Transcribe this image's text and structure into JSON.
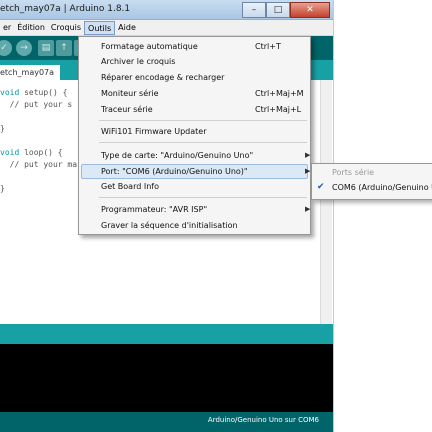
{
  "window": {
    "title": "etch_may07a | Arduino 1.8.1",
    "buttons": {
      "minimize": "–",
      "maximize": "□",
      "close": "✕"
    }
  },
  "menubar": {
    "items": [
      "er",
      "Édition",
      "Croquis",
      "Outils",
      "Aide"
    ],
    "active": "Outils"
  },
  "toolbar": {
    "icons": [
      "verify-icon",
      "upload-icon",
      "new-icon",
      "open-icon",
      "save-icon"
    ]
  },
  "editor": {
    "tab_label": "etch_may07a",
    "lines": [
      {
        "kw": "void",
        "rest": " setup() {"
      },
      {
        "kw": "",
        "rest": "  // put your s"
      },
      {
        "kw": "",
        "rest": "}"
      },
      {
        "kw": "void",
        "rest": " loop() {"
      },
      {
        "kw": "",
        "rest": "  // put your ma"
      },
      {
        "kw": "",
        "rest": "}"
      }
    ]
  },
  "tools_menu": {
    "items": [
      {
        "label": "Formatage automatique",
        "shortcut": "Ctrl+T"
      },
      {
        "label": "Archiver le croquis",
        "shortcut": ""
      },
      {
        "label": "Réparer encodage & recharger",
        "shortcut": ""
      },
      {
        "label": "Moniteur série",
        "shortcut": "Ctrl+Maj+M"
      },
      {
        "label": "Traceur série",
        "shortcut": "Ctrl+Maj+L"
      },
      {
        "label": "WiFi101 Firmware Updater",
        "shortcut": ""
      },
      {
        "label": "Type de carte: \"Arduino/Genuino Uno\"",
        "shortcut": "",
        "submenu": true
      },
      {
        "label": "Port: \"COM6 (Arduino/Genuino Uno)\"",
        "shortcut": "",
        "submenu": true
      },
      {
        "label": "Get Board Info",
        "shortcut": ""
      },
      {
        "label": "Programmateur: \"AVR ISP\"",
        "shortcut": "",
        "submenu": true
      },
      {
        "label": "Graver la séquence d'initialisation",
        "shortcut": ""
      }
    ],
    "highlighted": "Port: \"COM6 (Arduino/Genuino Uno)\""
  },
  "port_submenu": {
    "header": "Ports série",
    "item": "COM6 (Arduino/Genuino U",
    "checked": true
  },
  "statusbar": {
    "text": "Arduino/Genuino Uno sur COM6"
  },
  "colors": {
    "toolbar": "#006468",
    "tab_row": "#17a1a5",
    "console": "#000000",
    "highlight": "#dbe8f6"
  }
}
